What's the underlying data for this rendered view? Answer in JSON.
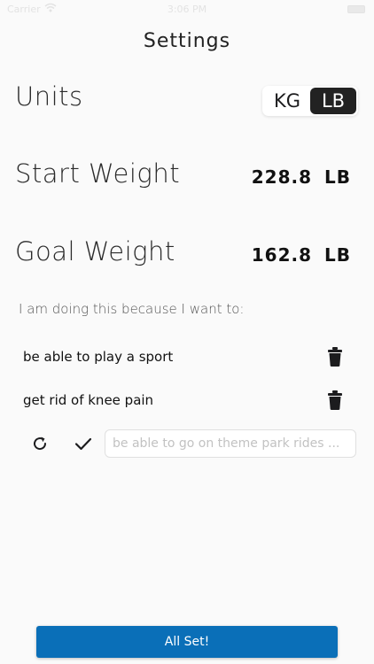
{
  "status_bar": {
    "carrier": "Carrier",
    "time": "3:06 PM"
  },
  "header": {
    "title": "Settings"
  },
  "units": {
    "label": "Units",
    "options": [
      "KG",
      "LB"
    ],
    "selected": "LB"
  },
  "start_weight": {
    "label": "Start Weight",
    "value": "228.8",
    "unit": "LB"
  },
  "goal_weight": {
    "label": "Goal Weight",
    "value": "162.8",
    "unit": "LB"
  },
  "reasons": {
    "heading": "I am doing this because I want to:",
    "items": [
      {
        "text": "be able to play a sport",
        "icon": "trash-icon"
      },
      {
        "text": "get rid of knee pain",
        "icon": "trash-icon"
      }
    ],
    "new_reason": {
      "value": "",
      "placeholder": "be able to go on theme park rides ...",
      "refresh_icon": "refresh-icon",
      "confirm_icon": "checkmark-icon"
    }
  },
  "footer": {
    "submit_label": "All Set!"
  },
  "colors": {
    "primary_button": "#0a6fb8",
    "toggle_selected": "#222222",
    "background": "#fafafa"
  }
}
